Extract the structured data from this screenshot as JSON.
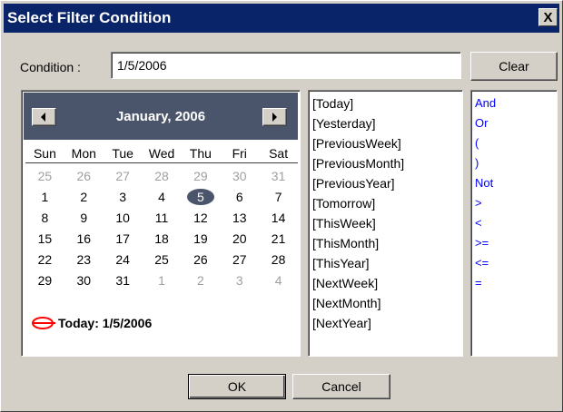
{
  "window": {
    "title": "Select Filter Condition",
    "close_label": "X"
  },
  "condition": {
    "label": "Condition :",
    "value": "1/5/2006"
  },
  "buttons": {
    "clear": "Clear",
    "ok": "OK",
    "cancel": "Cancel"
  },
  "calendar": {
    "month_label": "January, 2006",
    "days_of_week": [
      "Sun",
      "Mon",
      "Tue",
      "Wed",
      "Thu",
      "Fri",
      "Sat"
    ],
    "weeks": [
      [
        {
          "d": "25",
          "o": true
        },
        {
          "d": "26",
          "o": true
        },
        {
          "d": "27",
          "o": true
        },
        {
          "d": "28",
          "o": true
        },
        {
          "d": "29",
          "o": true
        },
        {
          "d": "30",
          "o": true
        },
        {
          "d": "31",
          "o": true
        }
      ],
      [
        {
          "d": "1"
        },
        {
          "d": "2"
        },
        {
          "d": "3"
        },
        {
          "d": "4"
        },
        {
          "d": "5",
          "s": true
        },
        {
          "d": "6"
        },
        {
          "d": "7"
        }
      ],
      [
        {
          "d": "8"
        },
        {
          "d": "9"
        },
        {
          "d": "10"
        },
        {
          "d": "11"
        },
        {
          "d": "12"
        },
        {
          "d": "13"
        },
        {
          "d": "14"
        }
      ],
      [
        {
          "d": "15"
        },
        {
          "d": "16"
        },
        {
          "d": "17"
        },
        {
          "d": "18"
        },
        {
          "d": "19"
        },
        {
          "d": "20"
        },
        {
          "d": "21"
        }
      ],
      [
        {
          "d": "22"
        },
        {
          "d": "23"
        },
        {
          "d": "24"
        },
        {
          "d": "25"
        },
        {
          "d": "26"
        },
        {
          "d": "27"
        },
        {
          "d": "28"
        }
      ],
      [
        {
          "d": "29"
        },
        {
          "d": "30"
        },
        {
          "d": "31"
        },
        {
          "d": "1",
          "o": true
        },
        {
          "d": "2",
          "o": true
        },
        {
          "d": "3",
          "o": true
        },
        {
          "d": "4",
          "o": true
        }
      ]
    ],
    "today_label": "Today: 1/5/2006"
  },
  "keywords": [
    "[Today]",
    "[Yesterday]",
    "[PreviousWeek]",
    "[PreviousMonth]",
    "[PreviousYear]",
    "[Tomorrow]",
    "[ThisWeek]",
    "[ThisMonth]",
    "[ThisYear]",
    "[NextWeek]",
    "[NextMonth]",
    "[NextYear]"
  ],
  "operators": [
    "And",
    "Or",
    "(",
    ")",
    "Not",
    ">",
    "<",
    ">=",
    "<=",
    "="
  ],
  "colors": {
    "titlebar": "#0a246a",
    "calendar_header": "#4a556b",
    "operator_text": "#0000ff",
    "today_circle": "#ff0000"
  }
}
